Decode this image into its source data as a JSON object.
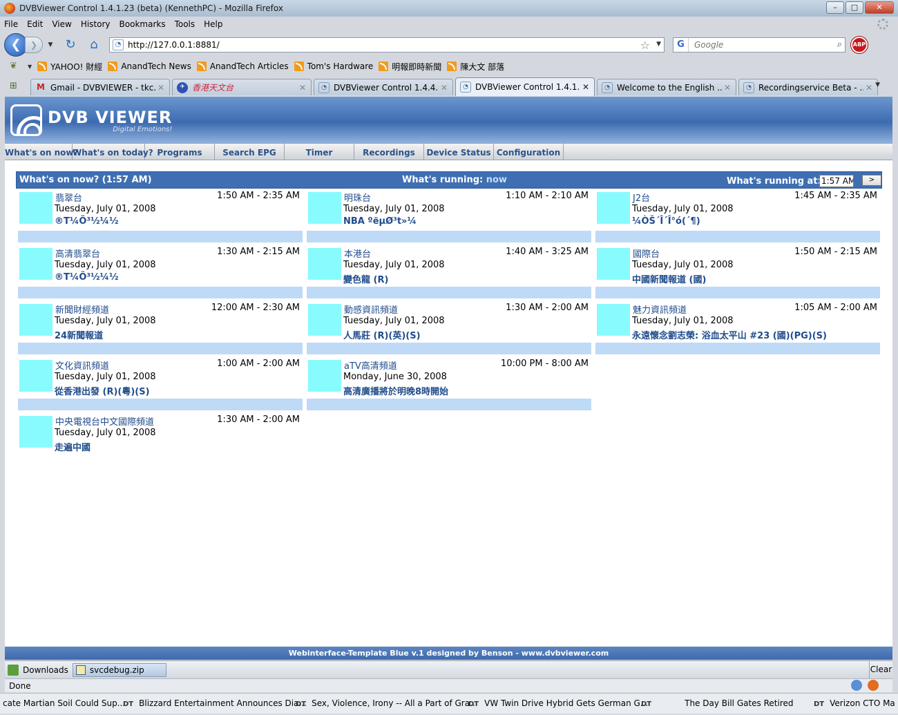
{
  "window": {
    "title": "DVBViewer Control 1.4.1.23 (beta) (KennethPC) - Mozilla Firefox"
  },
  "menu": [
    "File",
    "Edit",
    "View",
    "History",
    "Bookmarks",
    "Tools",
    "Help"
  ],
  "url": "http://127.0.0.1:8881/",
  "search_placeholder": "Google",
  "bookmarks": [
    "YAHOO! 財經",
    "AnandTech News",
    "AnandTech Articles",
    "Tom's Hardware",
    "明報即時新聞",
    "陳大文 部落"
  ],
  "tabs": [
    {
      "label": "Gmail - DVBVIEWER - tkc...",
      "icon": "M"
    },
    {
      "label": "香港天文台",
      "icon": "✈"
    },
    {
      "label": "DVBViewer Control 1.4.4....",
      "icon": "◔"
    },
    {
      "label": "DVBViewer Control 1.4.1...",
      "icon": "◔"
    },
    {
      "label": "Welcome to the English ...",
      "icon": "◔"
    },
    {
      "label": "Recordingservice Beta - ...",
      "icon": "◔"
    }
  ],
  "logo": {
    "brand": "DVB VIEWER",
    "slogan": "Digital Emotions!"
  },
  "nav": [
    "What's on now?",
    "What's on today?",
    "Programs",
    "Search EPG",
    "Timer",
    "Recordings",
    "Device Status",
    "Configuration"
  ],
  "panel": {
    "title": "What's on now? (1:57 AM)",
    "running_label": "What's running:",
    "running_link": "now",
    "at_label": "What's running at:",
    "at_value": "1:57 AM",
    "go": ">"
  },
  "channels": [
    {
      "name": "翡翠台",
      "time": "1:50 AM - 2:35 AM",
      "date": "Tuesday, July 01, 2008",
      "program": "®T¼Ö³½¼½"
    },
    {
      "name": "明珠台",
      "time": "1:10 AM - 2:10 AM",
      "date": "Tuesday, July 01, 2008",
      "program": "NBA ºëµØ³t»¼"
    },
    {
      "name": "J2台",
      "time": "1:45 AM - 2:35 AM",
      "date": "Tuesday, July 01, 2008",
      "program": "¼ÒŠ´Î´Î°ó(´¶)"
    },
    {
      "name": "高清翡翠台",
      "time": "1:30 AM - 2:15 AM",
      "date": "Tuesday, July 01, 2008",
      "program": "®T¼Ö³½¼½"
    },
    {
      "name": "本港台",
      "time": "1:40 AM - 3:25 AM",
      "date": "Tuesday, July 01, 2008",
      "program": "變色龍 (R)"
    },
    {
      "name": "國際台",
      "time": "1:50 AM - 2:15 AM",
      "date": "Tuesday, July 01, 2008",
      "program": "中國新聞報道 (國)"
    },
    {
      "name": "新聞財經頻道",
      "time": "12:00 AM - 2:30 AM",
      "date": "Tuesday, July 01, 2008",
      "program": "24新聞報道"
    },
    {
      "name": "動感資訊頻道",
      "time": "1:30 AM - 2:00 AM",
      "date": "Tuesday, July 01, 2008",
      "program": "人馬莊 (R)(英)(S)"
    },
    {
      "name": "魅力資訊頻道",
      "time": "1:05 AM - 2:00 AM",
      "date": "Tuesday, July 01, 2008",
      "program": "永遠懷念劉志榮: 浴血太平山 #23 (國)(PG)(S)"
    },
    {
      "name": "文化資訊頻道",
      "time": "1:00 AM - 2:00 AM",
      "date": "Tuesday, July 01, 2008",
      "program": "從香港出發 (R)(粵)(S)"
    },
    {
      "name": "aTV高清頻道",
      "time": "10:00 PM - 8:00 AM",
      "date": "Monday, June 30, 2008",
      "program": "高清廣播將於明晚8時開始"
    },
    {
      "name": "中央電視台中文國際頻道",
      "time": "1:30 AM - 2:00 AM",
      "date": "Tuesday, July 01, 2008",
      "program": "走遍中國"
    }
  ],
  "footer": "Webinterface-Template Blue v.1 designed by Benson - www.dvbviewer.com",
  "downloads": {
    "label": "Downloads",
    "file": "svcdebug.zip",
    "clear": "Clear"
  },
  "status": "Done",
  "ticker": [
    "cate Martian Soil Could Sup...",
    "Blizzard Entertainment Announces Dia...",
    "Sex, Violence, Irony -- All a Part of Gra...",
    "VW Twin Drive Hybrid Gets German G...",
    "The Day Bill Gates Retired",
    "Verizon CTO Ma"
  ],
  "ticker_prefix": "DT"
}
